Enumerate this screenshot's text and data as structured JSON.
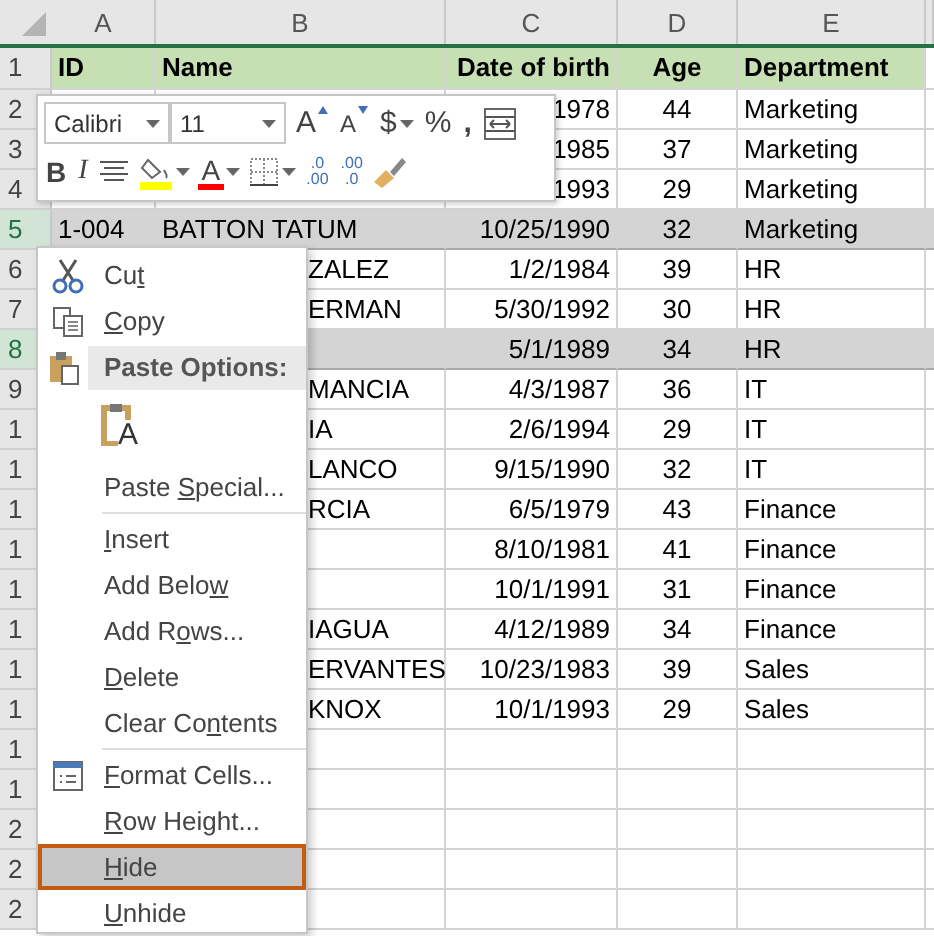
{
  "columns": [
    "A",
    "B",
    "C",
    "D",
    "E"
  ],
  "rows": [
    {
      "header": "1",
      "kind": "title",
      "selected": false,
      "cells": [
        "ID",
        "Name",
        "Date of birth",
        "Age",
        "Department"
      ]
    },
    {
      "header": "2",
      "kind": "data",
      "selected": false,
      "cells": [
        "",
        "",
        "1978",
        "44",
        "Marketing"
      ]
    },
    {
      "header": "3",
      "kind": "data",
      "selected": false,
      "cells": [
        "",
        "",
        "1985",
        "37",
        "Marketing"
      ]
    },
    {
      "header": "4",
      "kind": "data",
      "selected": false,
      "cells": [
        "",
        "",
        "1993",
        "29",
        "Marketing"
      ]
    },
    {
      "header": "5",
      "kind": "data",
      "selected": true,
      "cells": [
        "1-004",
        "BATTON TATUM",
        "10/25/1990",
        "32",
        "Marketing"
      ]
    },
    {
      "header": "6",
      "kind": "data",
      "selected": false,
      "cells": [
        "",
        "ZALEZ",
        "1/2/1984",
        "39",
        "HR"
      ]
    },
    {
      "header": "7",
      "kind": "data",
      "selected": false,
      "cells": [
        "",
        "ERMAN",
        "5/30/1992",
        "30",
        "HR"
      ]
    },
    {
      "header": "8",
      "kind": "data",
      "selected": true,
      "cells": [
        "",
        "",
        "5/1/1989",
        "34",
        "HR"
      ]
    },
    {
      "header": "9",
      "kind": "data",
      "selected": false,
      "cells": [
        "",
        "MANCIA",
        "4/3/1987",
        "36",
        "IT"
      ]
    },
    {
      "header": "1",
      "kind": "data",
      "selected": false,
      "cells": [
        "",
        "IA",
        "2/6/1994",
        "29",
        "IT"
      ]
    },
    {
      "header": "1",
      "kind": "data",
      "selected": false,
      "cells": [
        "",
        "LANCO",
        "9/15/1990",
        "32",
        "IT"
      ]
    },
    {
      "header": "1",
      "kind": "data",
      "selected": false,
      "cells": [
        "",
        "RCIA",
        "6/5/1979",
        "43",
        "Finance"
      ]
    },
    {
      "header": "1",
      "kind": "data",
      "selected": false,
      "cells": [
        "",
        "",
        "8/10/1981",
        "41",
        "Finance"
      ]
    },
    {
      "header": "1",
      "kind": "data",
      "selected": false,
      "cells": [
        "",
        "",
        "10/1/1991",
        "31",
        "Finance"
      ]
    },
    {
      "header": "1",
      "kind": "data",
      "selected": false,
      "cells": [
        "",
        "IAGUA",
        "4/12/1989",
        "34",
        "Finance"
      ]
    },
    {
      "header": "1",
      "kind": "data",
      "selected": false,
      "cells": [
        "",
        "ERVANTES",
        "10/23/1983",
        "39",
        "Sales"
      ]
    },
    {
      "header": "1",
      "kind": "data",
      "selected": false,
      "cells": [
        "",
        "KNOX",
        "10/1/1993",
        "29",
        "Sales"
      ]
    },
    {
      "header": "1",
      "kind": "data",
      "selected": false,
      "cells": [
        "",
        "",
        "",
        "",
        ""
      ]
    },
    {
      "header": "1",
      "kind": "data",
      "selected": false,
      "cells": [
        "",
        "",
        "",
        "",
        ""
      ]
    },
    {
      "header": "2",
      "kind": "data",
      "selected": false,
      "cells": [
        "",
        "",
        "",
        "",
        ""
      ]
    },
    {
      "header": "2",
      "kind": "data",
      "selected": false,
      "cells": [
        "",
        "",
        "",
        "",
        ""
      ]
    },
    {
      "header": "2",
      "kind": "data",
      "selected": false,
      "cells": [
        "",
        "",
        "",
        "",
        ""
      ]
    }
  ],
  "mini_toolbar": {
    "font": "Calibri",
    "size": "11",
    "row_1": [
      {
        "kind": "grow",
        "label": "A"
      },
      {
        "kind": "shrink",
        "label": "A"
      },
      {
        "kind": "currency",
        "label": "$",
        "has_caret": true
      },
      {
        "kind": "percent",
        "label": "%"
      },
      {
        "kind": "comma",
        "label": ","
      },
      {
        "kind": "wrap"
      }
    ],
    "row_2": [
      {
        "kind": "bold",
        "label": "B"
      },
      {
        "kind": "italic",
        "label": "I"
      },
      {
        "kind": "align"
      },
      {
        "kind": "fill",
        "color": "#ffff00",
        "has_caret": true
      },
      {
        "kind": "font-color",
        "label": "A",
        "color": "#ff0000",
        "has_caret": true
      },
      {
        "kind": "borders",
        "has_caret": true
      },
      {
        "kind": "inc-decimal",
        "labels": [
          ".0",
          ".00"
        ]
      },
      {
        "kind": "dec-decimal",
        "labels": [
          ".00",
          ".0"
        ]
      },
      {
        "kind": "painter"
      }
    ]
  },
  "context_menu": [
    {
      "kind": "cut-item",
      "before": "Cu",
      "key": "t",
      "selected": false
    },
    {
      "kind": "copy-item",
      "key": "C",
      "after": "opy",
      "selected": false
    },
    {
      "kind": "header",
      "text": "Paste Options:"
    },
    {
      "kind": "paste-option",
      "label": "A"
    },
    {
      "kind": "item",
      "before": "Paste ",
      "key": "S",
      "after": "pecial...",
      "selected": false
    },
    {
      "kind": "separator"
    },
    {
      "kind": "item",
      "key": "I",
      "after": "nsert",
      "selected": false
    },
    {
      "kind": "item",
      "before": "Add Belo",
      "key": "w",
      "selected": false
    },
    {
      "kind": "item",
      "before": "Add R",
      "key": "o",
      "after": "ws...",
      "selected": false
    },
    {
      "kind": "item",
      "key": "D",
      "after": "elete",
      "selected": false
    },
    {
      "kind": "item",
      "before": "Clear Co",
      "key": "n",
      "after": "tents",
      "selected": false
    },
    {
      "kind": "separator"
    },
    {
      "kind": "format-item",
      "key": "F",
      "after": "ormat Cells...",
      "selected": false
    },
    {
      "kind": "item",
      "key": "R",
      "after": "ow Height...",
      "selected": false
    },
    {
      "kind": "item",
      "key": "H",
      "after": "ide",
      "selected": true
    },
    {
      "kind": "item",
      "key": "U",
      "after": "nhide",
      "selected": false
    }
  ]
}
